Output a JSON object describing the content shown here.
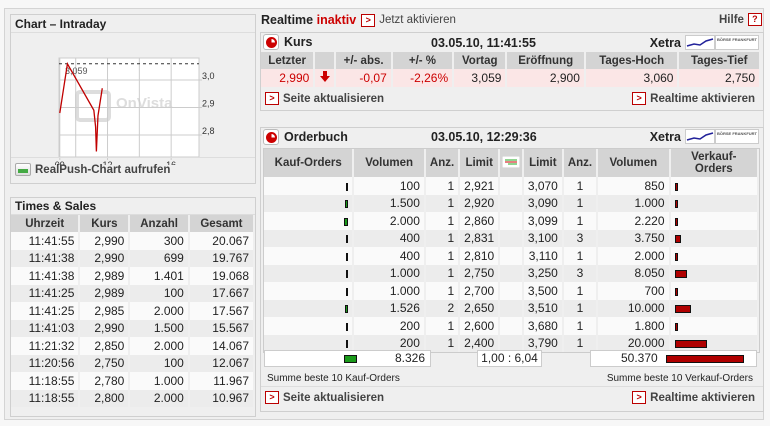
{
  "chart_box": {
    "title": "Chart – Intraday",
    "link": "RealPush-Chart aufrufen",
    "watermark": "OnVista",
    "chart_data": {
      "type": "line",
      "x": [
        9.0,
        9.48,
        11.14,
        11.25,
        11.3,
        11.4,
        11.67
      ],
      "y": [
        2.88,
        3.059,
        2.89,
        2.83,
        2.74,
        2.87,
        2.97
      ],
      "reference_line": 3.059,
      "reference_label": "3,059",
      "xticks": [
        "09",
        "12",
        "16"
      ],
      "xtick_values": [
        9,
        12,
        16
      ],
      "yticks": [
        "3,0",
        "2,9",
        "2,8"
      ],
      "ytick_values": [
        3.0,
        2.9,
        2.8
      ],
      "xlim": [
        8.95,
        17.75
      ],
      "ylim": [
        2.72,
        3.08
      ],
      "grid": true,
      "color": "#c00000"
    }
  },
  "times_sales": {
    "title": "Times & Sales",
    "columns": [
      "Uhrzeit",
      "Kurs",
      "Anzahl",
      "Gesamt"
    ],
    "rows": [
      [
        "11:41:55",
        "2,990",
        "300",
        "20.067"
      ],
      [
        "11:41:38",
        "2,990",
        "699",
        "19.767"
      ],
      [
        "11:41:38",
        "2,989",
        "1.401",
        "19.068"
      ],
      [
        "11:41:25",
        "2,989",
        "100",
        "17.667"
      ],
      [
        "11:41:25",
        "2,985",
        "2.000",
        "17.567"
      ],
      [
        "11:41:03",
        "2,990",
        "1.500",
        "15.567"
      ],
      [
        "11:21:32",
        "2,850",
        "2.000",
        "14.067"
      ],
      [
        "11:20:56",
        "2,750",
        "100",
        "12.067"
      ],
      [
        "11:18:55",
        "2,780",
        "1.000",
        "11.967"
      ],
      [
        "11:18:55",
        "2,800",
        "2.000",
        "10.967"
      ]
    ]
  },
  "header": {
    "realtime": "Realtime",
    "status": "inaktiv",
    "activate": "Jetzt aktivieren",
    "help": "Hilfe",
    "help_icon": "?"
  },
  "kurs": {
    "title": "Kurs",
    "timestamp": "03.05.10, 11:41:55",
    "exchange": "Xetra",
    "exchange_logo": "BÖRSE FRANKFURT",
    "columns": [
      "Letzter",
      "",
      "+/- abs.",
      "+/- %",
      "Vortag",
      "Eröffnung",
      "Tages-Hoch",
      "Tages-Tief"
    ],
    "values": {
      "last": "2,990",
      "trend": "down",
      "abs": "-0,07",
      "pct": "-2,26%",
      "prev": "3,059",
      "open": "2,900",
      "high": "3,060",
      "low": "2,750"
    },
    "refresh": "Seite aktualisieren",
    "realtime": "Realtime aktivieren"
  },
  "orderbuch": {
    "title": "Orderbuch",
    "timestamp": "03.05.10, 12:29:36",
    "exchange": "Xetra",
    "exchange_logo": "BÖRSE FRANKFURT",
    "columns": [
      "Kauf-Orders",
      "Volumen",
      "Anz.",
      "Limit",
      "",
      "Limit",
      "Anz.",
      "Volumen",
      "Verkauf-Orders"
    ],
    "rows": [
      {
        "bvol": "100",
        "bn": 100,
        "banz": "1",
        "blim": "2,921",
        "slim": "3,070",
        "sanz": "1",
        "svol": "850",
        "sn": 850
      },
      {
        "bvol": "1.500",
        "bn": 1500,
        "banz": "1",
        "blim": "2,920",
        "slim": "3,090",
        "sanz": "1",
        "svol": "1.000",
        "sn": 1000
      },
      {
        "bvol": "2.000",
        "bn": 2000,
        "banz": "1",
        "blim": "2,860",
        "slim": "3,099",
        "sanz": "1",
        "svol": "2.220",
        "sn": 2220
      },
      {
        "bvol": "400",
        "bn": 400,
        "banz": "1",
        "blim": "2,831",
        "slim": "3,100",
        "sanz": "3",
        "svol": "3.750",
        "sn": 3750
      },
      {
        "bvol": "400",
        "bn": 400,
        "banz": "1",
        "blim": "2,810",
        "slim": "3,110",
        "sanz": "1",
        "svol": "2.000",
        "sn": 2000
      },
      {
        "bvol": "1.000",
        "bn": 1000,
        "banz": "1",
        "blim": "2,750",
        "slim": "3,250",
        "sanz": "3",
        "svol": "8.050",
        "sn": 8050
      },
      {
        "bvol": "1.000",
        "bn": 1000,
        "banz": "1",
        "blim": "2,700",
        "slim": "3,500",
        "sanz": "1",
        "svol": "700",
        "sn": 700
      },
      {
        "bvol": "1.526",
        "bn": 1526,
        "banz": "2",
        "blim": "2,650",
        "slim": "3,510",
        "sanz": "1",
        "svol": "10.000",
        "sn": 10000
      },
      {
        "bvol": "200",
        "bn": 200,
        "banz": "1",
        "blim": "2,600",
        "slim": "3,680",
        "sanz": "1",
        "svol": "1.800",
        "sn": 1800
      },
      {
        "bvol": "200",
        "bn": 200,
        "banz": "1",
        "blim": "2,400",
        "slim": "3,790",
        "sanz": "1",
        "svol": "20.000",
        "sn": 20000
      }
    ],
    "sum_buy": "8.326",
    "sum_buy_n": 8326,
    "ratio": "1,00 : 6,04",
    "sum_sell": "50.370",
    "sum_sell_n": 50370,
    "sum_buy_label": "Summe beste 10 Kauf-Orders",
    "sum_sell_label": "Summe beste 10 Verkauf-Orders",
    "refresh": "Seite aktualisieren",
    "realtime": "Realtime aktivieren"
  },
  "colors": {
    "buy": "#1a9a1a",
    "sell": "#b00000",
    "negative": "#cc0000",
    "row_highlight": "#fbe6e6"
  }
}
